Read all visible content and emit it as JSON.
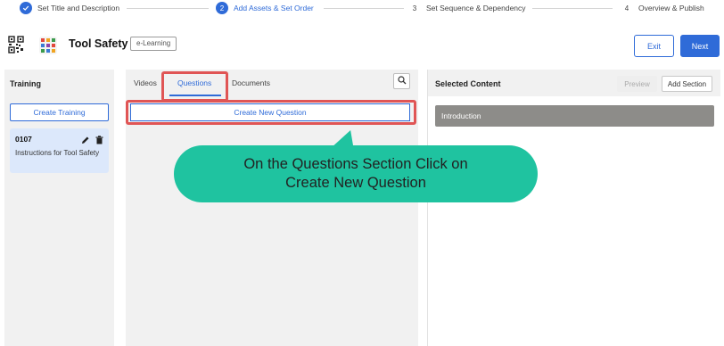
{
  "stepper": {
    "steps": [
      {
        "number": "",
        "label": "Set Title and Description",
        "state": "done"
      },
      {
        "number": "2",
        "label": "Add Assets & Set Order",
        "state": "active"
      },
      {
        "number": "3",
        "label": "Set Sequence & Dependency",
        "state": "todo"
      },
      {
        "number": "4",
        "label": "Overview & Publish",
        "state": "todo"
      }
    ]
  },
  "header": {
    "title": "Tool Safety",
    "badge": "e-Learning",
    "exit_label": "Exit",
    "next_label": "Next"
  },
  "training": {
    "title": "Training",
    "create_label": "Create Training",
    "card": {
      "id": "0107",
      "description": "Instructions for Tool Safety"
    }
  },
  "assets": {
    "tabs": [
      "Videos",
      "Questions",
      "Documents"
    ],
    "active_tab": "Questions",
    "create_question_label": "Create New Question"
  },
  "selected": {
    "title": "Selected Content",
    "preview_label": "Preview",
    "add_section_label": "Add Section",
    "items": [
      "Introduction"
    ]
  },
  "callout": {
    "line1": "On the Questions Section Click on",
    "line2": "Create New Question"
  },
  "colors": {
    "accent": "#2f6bd8",
    "callout": "#1fc3a0",
    "highlight": "#e05555"
  }
}
